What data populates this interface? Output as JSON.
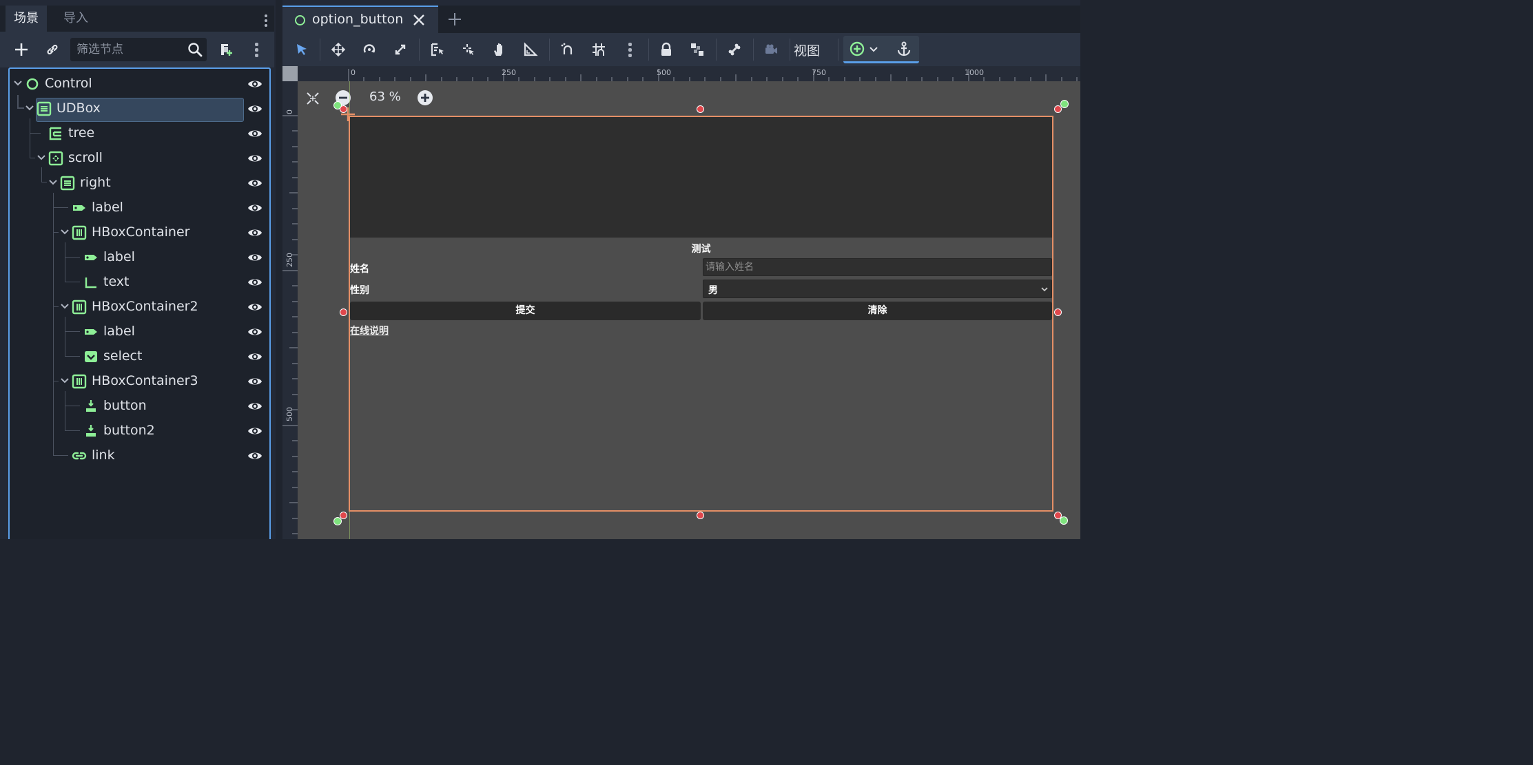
{
  "dock": {
    "tabs": [
      "场景",
      "导入"
    ],
    "filter_placeholder": "筛选节点"
  },
  "tree": {
    "nodes": [
      {
        "label": "Control",
        "icon": "control-icon"
      },
      {
        "label": "UDBox",
        "icon": "vbox-icon"
      },
      {
        "label": "tree",
        "icon": "tree-icon"
      },
      {
        "label": "scroll",
        "icon": "scroll-container-icon"
      },
      {
        "label": "right",
        "icon": "vbox-icon"
      },
      {
        "label": "label",
        "icon": "label-icon"
      },
      {
        "label": "HBoxContainer",
        "icon": "hbox-icon"
      },
      {
        "label": "label",
        "icon": "label-icon"
      },
      {
        "label": "text",
        "icon": "line-edit-icon"
      },
      {
        "label": "HBoxContainer2",
        "icon": "hbox-icon"
      },
      {
        "label": "label",
        "icon": "label-icon"
      },
      {
        "label": "select",
        "icon": "option-button-icon"
      },
      {
        "label": "HBoxContainer3",
        "icon": "hbox-icon"
      },
      {
        "label": "button",
        "icon": "button-icon"
      },
      {
        "label": "button2",
        "icon": "button-icon"
      },
      {
        "label": "link",
        "icon": "link-button-icon"
      }
    ]
  },
  "editor": {
    "scene_tab": "option_button",
    "view_menu": "视图",
    "zoom": "63 %",
    "ruler_h": [
      "0",
      "250",
      "500",
      "750",
      "1000"
    ],
    "ruler_v": [
      "0",
      "250",
      "500"
    ]
  },
  "form": {
    "title": "测试",
    "name_label": "姓名",
    "name_placeholder": "请输入姓名",
    "gender_label": "性别",
    "gender_value": "男",
    "submit": "提交",
    "clear": "清除",
    "link": "在线说明"
  },
  "colors": {
    "accent": "#5a9ee8",
    "node_green": "#8eef97",
    "selection_outline": "#e58f66",
    "handle_red": "#e0474c"
  }
}
